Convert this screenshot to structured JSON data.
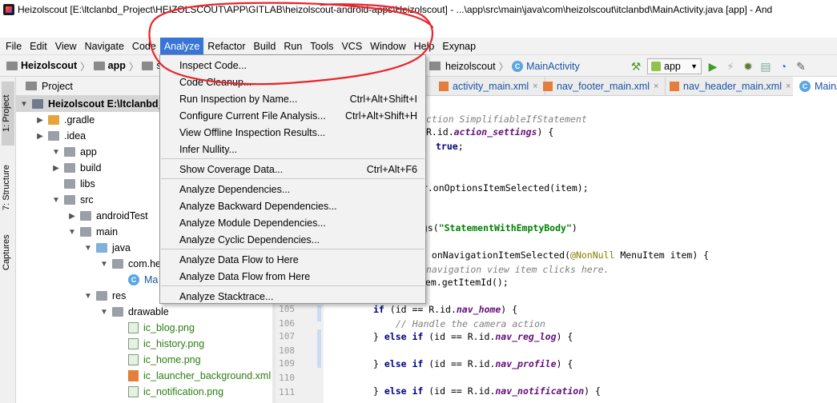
{
  "window": {
    "title": "Heizolscout [E:\\ltclanbd_Project\\HEIZOLSCOUT\\APP\\GITLAB\\heizolscout-android-apps\\Heizolscout] - ...\\app\\src\\main\\java\\com\\heizolscout\\itclanbd\\MainActivity.java [app] - And"
  },
  "menubar": {
    "items": [
      "File",
      "Edit",
      "View",
      "Navigate",
      "Code",
      "Analyze",
      "Refactor",
      "Build",
      "Run",
      "Tools",
      "VCS",
      "Window",
      "Help",
      "Exynap"
    ],
    "active": "Analyze"
  },
  "navbar": {
    "crumbs": [
      "Heizolscout",
      "app",
      "src"
    ],
    "right_crumbs": [
      "heizolscout",
      "MainActivity"
    ],
    "run_config": "app"
  },
  "side_tabs": [
    "1: Project",
    "7: Structure",
    "Captures"
  ],
  "project_panel": {
    "header": "Project",
    "tree": [
      {
        "label": "Heizolscout  E:\\ltclanbd_Pro",
        "depth": 0,
        "arrow": "down",
        "icon": "dark",
        "selected": true
      },
      {
        "label": ".gradle",
        "depth": 1,
        "arrow": "right",
        "icon": "orange"
      },
      {
        "label": ".idea",
        "depth": 1,
        "arrow": "right",
        "icon": "gray"
      },
      {
        "label": "app",
        "depth": 1,
        "arrow": "down",
        "icon": "gray"
      },
      {
        "label": "build",
        "depth": 2,
        "arrow": "right",
        "icon": "gray"
      },
      {
        "label": "libs",
        "depth": 2,
        "arrow": "",
        "icon": "gray"
      },
      {
        "label": "src",
        "depth": 2,
        "arrow": "down",
        "icon": "gray"
      },
      {
        "label": "androidTest",
        "depth": 3,
        "arrow": "right",
        "icon": "gray"
      },
      {
        "label": "main",
        "depth": 3,
        "arrow": "down",
        "icon": "gray"
      },
      {
        "label": "java",
        "depth": 4,
        "arrow": "down",
        "icon": "blue"
      },
      {
        "label": "com.he",
        "depth": 5,
        "arrow": "down",
        "icon": "gray"
      },
      {
        "label": "Ma",
        "depth": 6,
        "arrow": "",
        "icon": "class"
      },
      {
        "label": "res",
        "depth": 4,
        "arrow": "down",
        "icon": "gray"
      },
      {
        "label": "drawable",
        "depth": 5,
        "arrow": "down",
        "icon": "gray"
      },
      {
        "label": "ic_blog.png",
        "depth": 6,
        "arrow": "",
        "icon": "png"
      },
      {
        "label": "ic_history.png",
        "depth": 6,
        "arrow": "",
        "icon": "png"
      },
      {
        "label": "ic_home.png",
        "depth": 6,
        "arrow": "",
        "icon": "png"
      },
      {
        "label": "ic_launcher_background.xml",
        "depth": 6,
        "arrow": "",
        "icon": "xml"
      },
      {
        "label": "ic_notification.png",
        "depth": 6,
        "arrow": "",
        "icon": "png"
      }
    ]
  },
  "editor_tabs": [
    {
      "label": "activity_main.xml"
    },
    {
      "label": "nav_footer_main.xml"
    },
    {
      "label": "nav_header_main.xml"
    },
    {
      "label": "MainA"
    }
  ],
  "line_numbers": [
    "105",
    "106",
    "107",
    "108",
    "109",
    "110",
    "111"
  ],
  "analyze_menu": {
    "items": [
      {
        "label": "Inspect Code...",
        "shortcut": ""
      },
      {
        "label": "Code Cleanup...",
        "shortcut": ""
      },
      {
        "label": "Run Inspection by Name...",
        "shortcut": "Ctrl+Alt+Shift+I"
      },
      {
        "label": "Configure Current File Analysis...",
        "shortcut": "Ctrl+Alt+Shift+H"
      },
      {
        "label": "View Offline Inspection Results...",
        "shortcut": ""
      },
      {
        "label": "Infer Nullity...",
        "shortcut": ""
      },
      {
        "label": "Show Coverage Data...",
        "shortcut": "Ctrl+Alt+F6"
      },
      {
        "label": "Analyze Dependencies...",
        "shortcut": ""
      },
      {
        "label": "Analyze Backward Dependencies...",
        "shortcut": ""
      },
      {
        "label": "Analyze Module Dependencies...",
        "shortcut": ""
      },
      {
        "label": "Analyze Cyclic Dependencies...",
        "shortcut": ""
      },
      {
        "label": "Analyze Data Flow to Here",
        "shortcut": ""
      },
      {
        "label": "Analyze Data Flow from Here",
        "shortcut": ""
      },
      {
        "label": "Analyze Stacktrace...",
        "shortcut": ""
      }
    ]
  },
  "code": {
    "lines": [
      {
        "parts": [
          [
            "cm",
            "ction SimplifiableIfStatement"
          ]
        ]
      },
      {
        "parts": [
          [
            "",
            "R.id."
          ],
          [
            "fld",
            "action_settings"
          ],
          [
            "",
            ") {"
          ]
        ]
      },
      {
        "parts": [
          [
            "kw",
            "true"
          ],
          [
            "",
            ";"
          ]
        ]
      },
      {
        "parts": [
          [
            "",
            "er.onOptionsItemSelected(item);"
          ]
        ]
      },
      {
        "parts": [
          [
            "",
            "ngs("
          ],
          [
            "str",
            "\"StatementWithEmptyBody\""
          ],
          [
            "",
            ")"
          ]
        ]
      },
      {
        "parts": [
          [
            "",
            " onNavigationItemSelected("
          ],
          [
            "ann",
            "@NonNull"
          ],
          [
            "",
            " MenuItem item) {"
          ]
        ]
      },
      {
        "parts": [
          [
            "cm",
            "navigation view item clicks here."
          ]
        ]
      },
      {
        "parts": [
          [
            "",
            "tem.getItemId();"
          ]
        ]
      },
      {
        "parts": [
          [
            "kw",
            "if"
          ],
          [
            "",
            " (id == R.id."
          ],
          [
            "fld",
            "nav_home"
          ],
          [
            "",
            ") {"
          ]
        ]
      },
      {
        "parts": [
          [
            "cm",
            "// Handle the camera action"
          ]
        ]
      },
      {
        "parts": [
          [
            "",
            "} "
          ],
          [
            "kw",
            "else if"
          ],
          [
            "",
            " (id == R.id."
          ],
          [
            "fld",
            "nav_reg_log"
          ],
          [
            "",
            ") {"
          ]
        ]
      },
      {
        "parts": [
          [
            "",
            "} "
          ],
          [
            "kw",
            "else if"
          ],
          [
            "",
            " (id == R.id."
          ],
          [
            "fld",
            "nav_profile"
          ],
          [
            "",
            ") {"
          ]
        ]
      },
      {
        "parts": [
          [
            "",
            "} "
          ],
          [
            "kw",
            "else if"
          ],
          [
            "",
            " (id == R.id."
          ],
          [
            "fld",
            "nav_notification"
          ],
          [
            "",
            ") {"
          ]
        ]
      }
    ]
  },
  "colors": {
    "menu_highlight": "#3875d7",
    "annotation_red": "#e8252a"
  }
}
